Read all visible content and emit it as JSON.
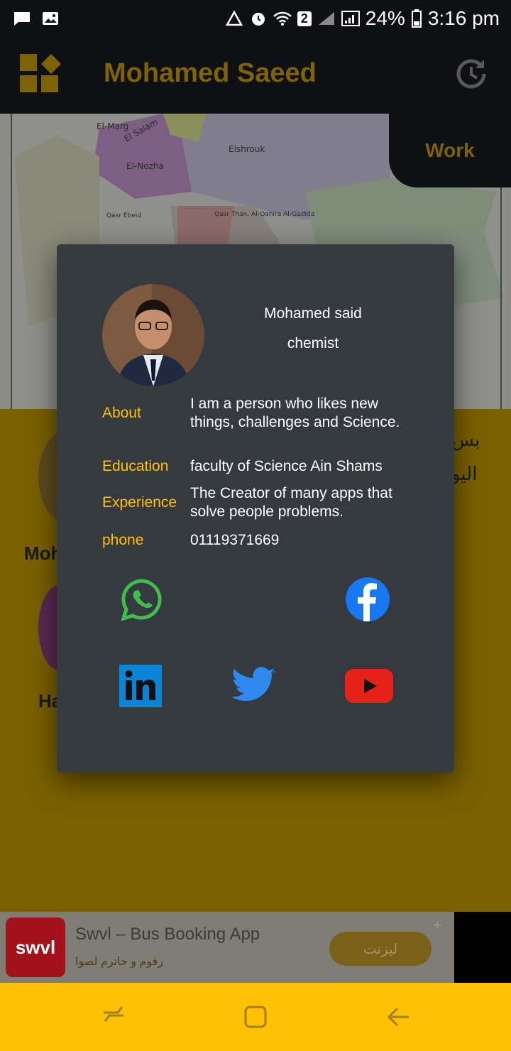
{
  "status_bar": {
    "battery": "24%",
    "time": "3:16 pm",
    "sim_badge": "2"
  },
  "app_bar": {
    "title": "Mohamed Saeed",
    "work_tab": "Work"
  },
  "map": {
    "labels": [
      "El-Marg",
      "El Salam",
      "El-Nozha",
      "Elshrouk",
      "Qasr Ebeid",
      "Qasr Than. Al-Qahira Al-Gadida"
    ]
  },
  "background": {
    "arabic_line_1": "بس",
    "arabic_line_2": "اليو",
    "partial_name_1": "Moh",
    "partial_name_2": "Ha"
  },
  "dialog": {
    "name": "Mohamed said",
    "role": "chemist",
    "rows": [
      {
        "label": "About",
        "value": "I am a person who likes new things, challenges and Science."
      },
      {
        "label": "Education",
        "value": "faculty of Science Ain Shams"
      },
      {
        "label": "Experience",
        "value": "The Creator of many apps that solve people problems."
      },
      {
        "label": "phone",
        "value": "01119371669"
      }
    ],
    "social": [
      "whatsapp-icon",
      "facebook-icon",
      "linkedin-icon",
      "twitter-icon",
      "youtube-icon"
    ]
  },
  "ad": {
    "logo_text": "swvl",
    "title": "Swvl – Bus Booking App",
    "subtitle": "رفوم و حاترم لصوا",
    "button": "ليزنت"
  },
  "colors": {
    "accent": "#ffc107",
    "dialog_bg": "#353940",
    "appbar": "#0f1013",
    "navbar": "#ffc106"
  }
}
